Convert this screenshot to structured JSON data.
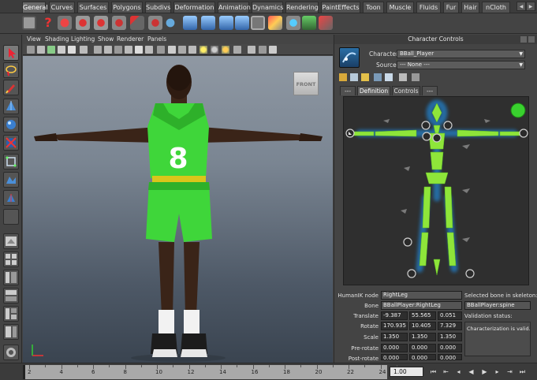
{
  "shelf": {
    "tabs": [
      "General",
      "Curves",
      "Surfaces",
      "Polygons",
      "Subdivs",
      "Deformation",
      "Animation",
      "Dynamics",
      "Rendering",
      "PaintEffects",
      "Toon",
      "Muscle",
      "Fluids",
      "Fur",
      "Hair",
      "nCloth"
    ],
    "active_tab": "General"
  },
  "viewport": {
    "menu": [
      "View",
      "Shading",
      "Lighting",
      "Show",
      "Renderer",
      "Panels"
    ],
    "view_cube_label": "FRONT",
    "jersey_number": "8"
  },
  "character_controls": {
    "title": "Character Controls",
    "character_label": "Character:",
    "character_value": "BBall_Player",
    "source_label": "Source:",
    "source_value": "--- None ---",
    "tabs": [
      "---",
      "Definition",
      "Controls",
      "---"
    ],
    "active_tab": "Definition",
    "humanik_node_label": "HumanIK node",
    "humanik_node_value": "RightLeg",
    "bone_label": "Bone",
    "bone_value": "BBallPlayer:RightLeg",
    "translate_label": "Translate",
    "translate": [
      "-9.387",
      "55.565",
      "0.051"
    ],
    "rotate_label": "Rotate",
    "rotate": [
      "170.935",
      "10.405",
      "7.329"
    ],
    "scale_label": "Scale",
    "scale": [
      "1.350",
      "1.350",
      "1.350"
    ],
    "pre_rotate_label": "Pre-rotate",
    "pre_rotate": [
      "0.000",
      "0.000",
      "0.000"
    ],
    "post_rotate_label": "Post-rotate",
    "post_rotate": [
      "0.000",
      "0.000",
      "0.000"
    ],
    "selected_bone_label": "Selected bone in skeleton:",
    "selected_bone_value": "BBallPlayer:spine",
    "validation_label": "Validation status:",
    "validation_value": "Characterization is valid."
  },
  "timeline": {
    "ticks": [
      "2",
      "4",
      "6",
      "8",
      "10",
      "12",
      "14",
      "16",
      "18",
      "20",
      "22",
      "24"
    ],
    "current_time": "1.00"
  },
  "colors": {
    "accent_green": "#39d12e",
    "bone_green": "#8ee53a",
    "bone_blue": "#1f9cff",
    "uniform_green": "#3fd63a"
  }
}
